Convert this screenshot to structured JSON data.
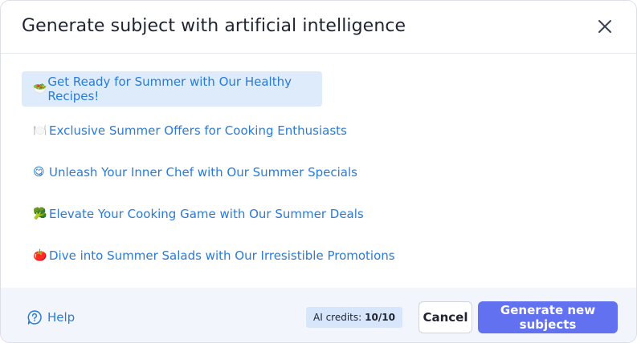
{
  "dialog": {
    "title": "Generate subject with artificial intelligence"
  },
  "suggestions": [
    {
      "emoji": "🥗",
      "text": "Get Ready for Summer with Our Healthy Recipes!",
      "selected": true
    },
    {
      "emoji": "🍽️",
      "text": "Exclusive Summer Offers for Cooking Enthusiasts",
      "selected": false
    },
    {
      "emoji": "😋",
      "text": "Unleash Your Inner Chef with Our Summer Specials",
      "selected": false
    },
    {
      "emoji": "🥦",
      "text": "Elevate Your Cooking Game with Our Summer Deals",
      "selected": false
    },
    {
      "emoji": "🍅",
      "text": "Dive into Summer Salads with Our Irresistible Promotions",
      "selected": false
    }
  ],
  "footer": {
    "help_label": "Help",
    "credits_label": "AI credits:",
    "credits_value": "10/10",
    "cancel_label": "Cancel",
    "generate_label": "Generate new subjects"
  },
  "colors": {
    "accent": "#6271f0",
    "link": "#2a7bd6",
    "selected_bg": "#ddebfb",
    "footer_bg": "#f2f5fb"
  },
  "icons": {
    "close": "close-icon",
    "help": "help-question-icon"
  }
}
